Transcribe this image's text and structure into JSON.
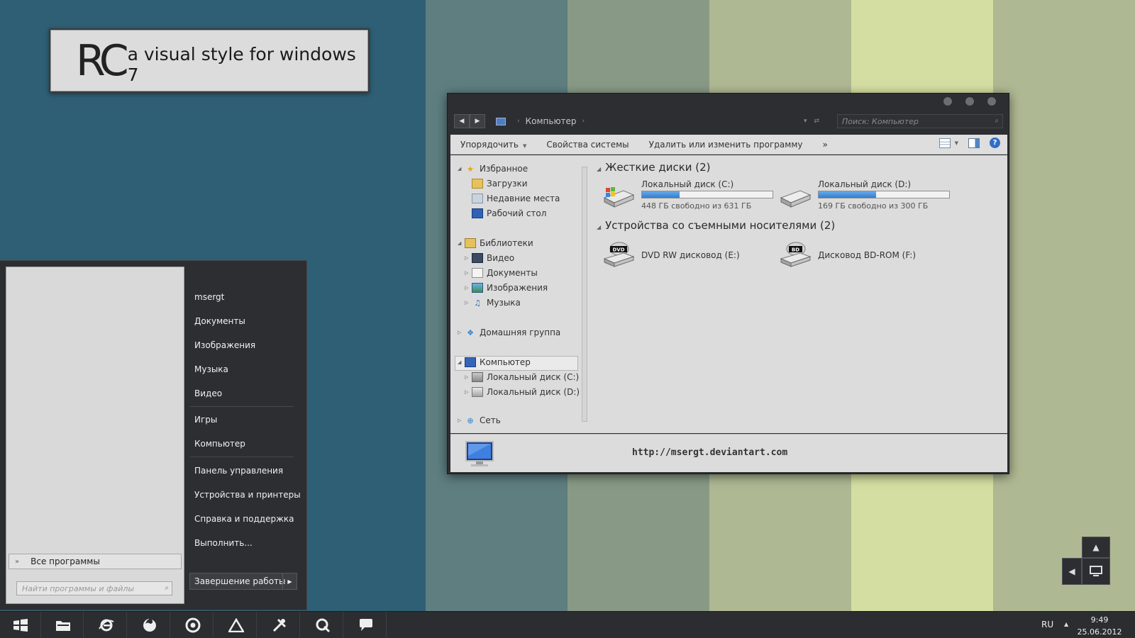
{
  "desktop": {
    "stripe_colors": [
      "#2f5f74",
      "#5e7e80",
      "#889a86",
      "#aeb892",
      "#d5dea2",
      "#aeb892"
    ],
    "logo": {
      "mark": "RC",
      "tagline": "a visual style for windows 7"
    }
  },
  "start_menu": {
    "user": "msergt",
    "items": [
      {
        "label": "msergt"
      },
      {
        "label": "Документы"
      },
      {
        "label": "Изображения"
      },
      {
        "label": "Музыка"
      },
      {
        "label": "Видео"
      },
      {
        "label": "Игры"
      },
      {
        "label": "Компьютер"
      },
      {
        "label": "Панель управления"
      },
      {
        "label": "Устройства и принтеры"
      },
      {
        "label": "Справка и поддержка"
      },
      {
        "label": "Выполнить..."
      }
    ],
    "all_programs": "Все программы",
    "search_placeholder": "Найти программы и файлы",
    "shutdown": "Завершение работы"
  },
  "explorer": {
    "breadcrumb": "Компьютер",
    "search_placeholder": "Поиск: Компьютер",
    "toolbar": {
      "organize": "Упорядочить",
      "system_properties": "Свойства системы",
      "uninstall": "Удалить или изменить программу",
      "more": "»"
    },
    "nav": {
      "favorites": "Избранное",
      "downloads": "Загрузки",
      "recent": "Недавние места",
      "desktop": "Рабочий стол",
      "libraries": "Библиотеки",
      "video": "Видео",
      "documents": "Документы",
      "images": "Изображения",
      "music": "Музыка",
      "homegroup": "Домашняя группа",
      "computer": "Компьютер",
      "drive_c": "Локальный диск (C:)",
      "drive_d": "Локальный диск (D:)",
      "network": "Сеть"
    },
    "groups": {
      "hard_drives": "Жесткие диски (2)",
      "removable": "Устройства со съемными носителями (2)"
    },
    "drives": [
      {
        "name": "Локальный диск (C:)",
        "free": "448 ГБ свободно из 631 ГБ",
        "used_fraction": 0.29
      },
      {
        "name": "Локальный диск (D:)",
        "free": "169 ГБ свободно из 300 ГБ",
        "used_fraction": 0.44
      }
    ],
    "devices": [
      {
        "name": "DVD RW дисковод (E:)",
        "badge": "DVD"
      },
      {
        "name": "Дисковод BD-ROM (F:)",
        "badge": "BD"
      }
    ],
    "details_url": "http://msergt.deviantart.com"
  },
  "taskbar": {
    "icons": [
      "start-orb-icon",
      "explorer-folder-icon",
      "internet-explorer-icon",
      "firefox-icon",
      "chrome-icon",
      "triangle-app-icon",
      "tools-icon",
      "quicktime-icon",
      "chat-icon"
    ],
    "lang": "RU",
    "time": "9:49",
    "date": "25.06.2012"
  }
}
